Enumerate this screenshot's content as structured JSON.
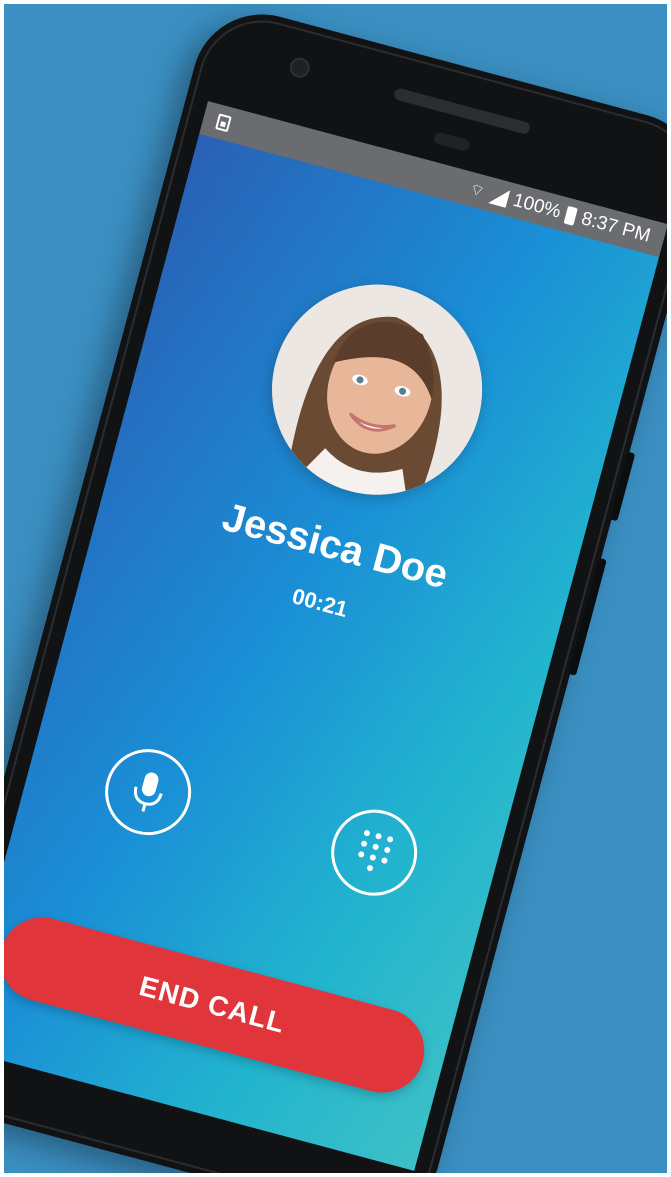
{
  "statusbar": {
    "battery": "100%",
    "time": "8:37 PM"
  },
  "call": {
    "caller_name": "Jessica Doe",
    "duration": "00:21",
    "end_call_label": "END CALL"
  },
  "icons": {
    "sim": "sim-card-icon",
    "wifi": "wifi-icon",
    "signal": "signal-icon",
    "battery": "battery-icon",
    "mute": "microphone-icon",
    "dialpad": "dialpad-icon"
  },
  "colors": {
    "background": "#3b8fc2",
    "phone_body": "#111214",
    "statusbar": "#6a6c70",
    "gradient_start": "#2a5fb5",
    "gradient_end": "#3cc0c6",
    "end_call": "#e0353b"
  }
}
